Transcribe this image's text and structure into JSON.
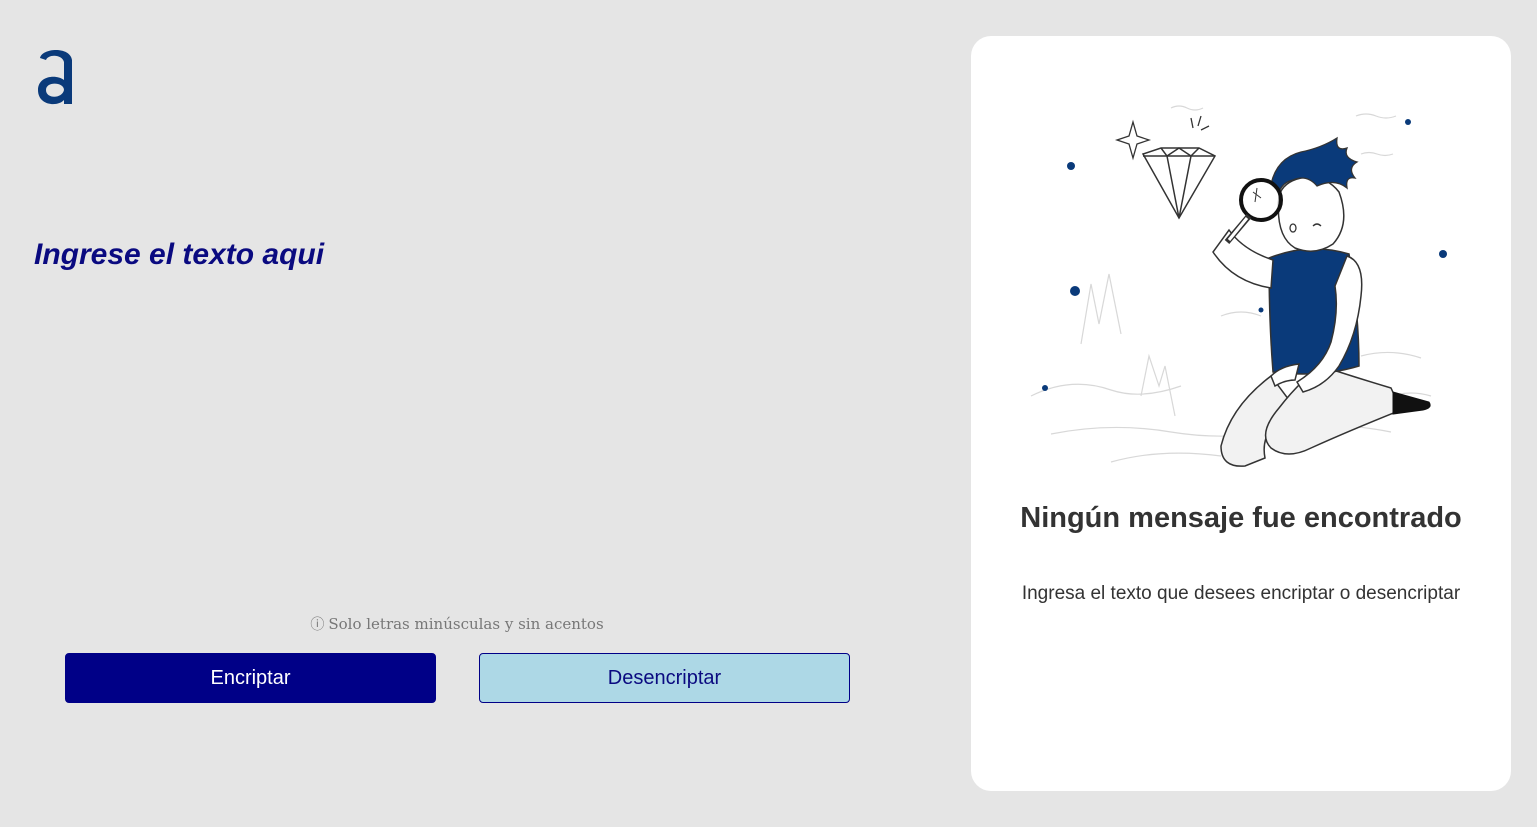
{
  "logo": {
    "icon": "alura-a-logo",
    "color": "#0a3a7a"
  },
  "input": {
    "placeholder": "Ingrese el texto aqui",
    "value": ""
  },
  "hint": {
    "icon": "info-icon",
    "icon_glyph": "ⓘ",
    "text": "Solo letras minúsculas y sin acentos"
  },
  "buttons": {
    "encrypt_label": "Encriptar",
    "decrypt_label": "Desencriptar"
  },
  "output": {
    "illustration": "person-with-magnifying-glass-illustration",
    "title": "Ningún mensaje fue encontrado",
    "subtitle": "Ingresa el texto que desees encriptar o desencriptar"
  },
  "colors": {
    "background": "#e5e5e5",
    "primary": "#000087",
    "secondary": "#add8e6",
    "accent": "#0a3a7a",
    "card": "#ffffff"
  }
}
